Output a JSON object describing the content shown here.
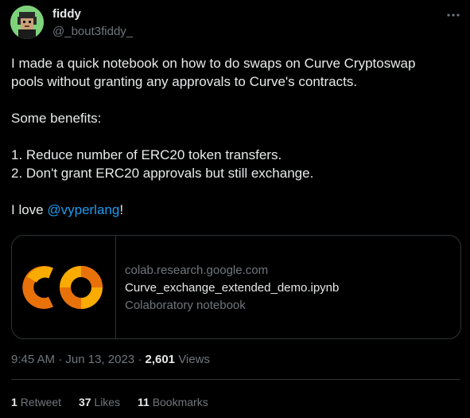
{
  "author": {
    "display_name": "fiddy",
    "handle": "@_bout3fiddy_"
  },
  "tweet": {
    "line1": "I made a quick notebook on how to do swaps on Curve Cryptoswap",
    "line2": "pools without granting any approvals to Curve's contracts.",
    "line3": "Some benefits:",
    "line4": "1. Reduce number of ERC20 token transfers.",
    "line5": "2. Don't grant ERC20 approvals but still exchange.",
    "line6_prefix": "I love ",
    "mention": "@vyperlang",
    "line6_suffix": "!"
  },
  "card": {
    "domain": "colab.research.google.com",
    "title": "Curve_exchange_extended_demo.ipynb",
    "description": "Colaboratory notebook",
    "logo_icon": "colab-logo-icon",
    "logo_colors": [
      "#e8710a",
      "#f9ab00"
    ]
  },
  "meta": {
    "time": "9:45 AM",
    "date": "Jun 13, 2023",
    "separator": "·",
    "views_count": "2,601",
    "views_label": "Views"
  },
  "stats": {
    "retweets_count": "1",
    "retweets_label": "Retweet",
    "likes_count": "37",
    "likes_label": "Likes",
    "bookmarks_count": "11",
    "bookmarks_label": "Bookmarks"
  },
  "colors": {
    "background": "#000000",
    "text": "#e7e9ea",
    "secondary": "#71767b",
    "link": "#1d9bf0",
    "border": "#2f3336"
  }
}
